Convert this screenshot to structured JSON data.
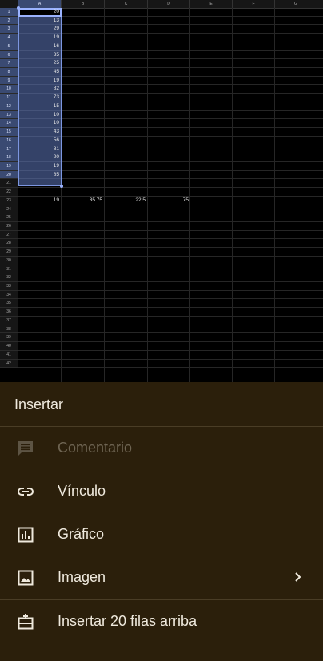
{
  "sheet": {
    "columns": [
      "A",
      "B",
      "C",
      "D",
      "E",
      "F",
      "G"
    ],
    "rows": [
      "1",
      "2",
      "3",
      "4",
      "5",
      "6",
      "7",
      "8",
      "9",
      "10",
      "11",
      "12",
      "13",
      "14",
      "15",
      "16",
      "17",
      "18",
      "19",
      "20",
      "21",
      "22",
      "23",
      "24",
      "25",
      "26",
      "27",
      "28",
      "29",
      "30",
      "31",
      "32",
      "33",
      "34",
      "35",
      "36",
      "37",
      "38",
      "39",
      "40",
      "41",
      "42"
    ],
    "column_a_values": [
      "20",
      "13",
      "29",
      "19",
      "16",
      "35",
      "25",
      "45",
      "19",
      "82",
      "73",
      "15",
      "10",
      "10",
      "43",
      "56",
      "81",
      "20",
      "19",
      "85"
    ],
    "row22": {
      "a": "19",
      "b": "35.75",
      "c": "22.5",
      "d": "75"
    }
  },
  "menu": {
    "title": "Insertar",
    "items": [
      {
        "label": "Comentario",
        "icon": "comment-icon",
        "disabled": true
      },
      {
        "label": "Vínculo",
        "icon": "link-icon"
      },
      {
        "label": "Gráfico",
        "icon": "chart-icon"
      },
      {
        "label": "Imagen",
        "icon": "image-icon",
        "has_submenu": true
      },
      {
        "label": "Insertar 20 filas arriba",
        "icon": "insert-rows-above-icon"
      }
    ]
  },
  "colors": {
    "menu_bg": "#2b1f0b",
    "selection": "#3a4a72",
    "accent": "#9bb3ff"
  }
}
